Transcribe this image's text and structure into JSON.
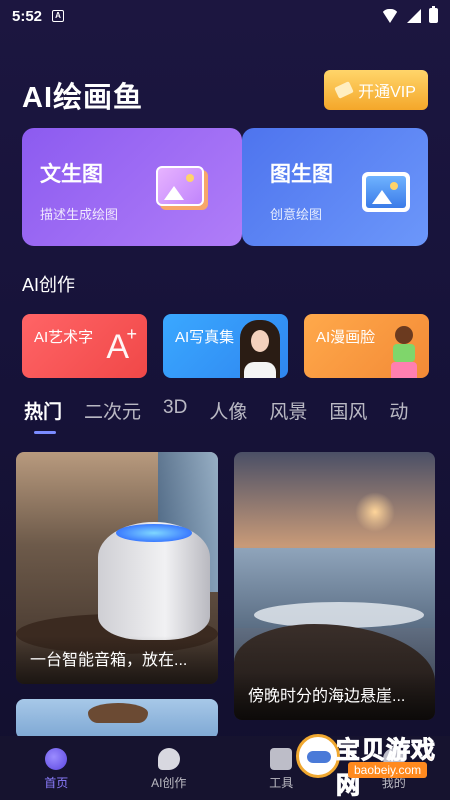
{
  "status_bar": {
    "time": "5:52",
    "notification_icon": "A"
  },
  "header": {
    "app_title": "AI绘画鱼",
    "vip_label": "开通VIP"
  },
  "features": [
    {
      "title": "文生图",
      "subtitle": "描述生成绘图",
      "icon": "image-stack-icon"
    },
    {
      "title": "图生图",
      "subtitle": "创意绘图",
      "icon": "picture-icon"
    }
  ],
  "ai_section": {
    "title": "AI创作",
    "items": [
      {
        "label": "AI艺术字",
        "icon": "letter-a-icon",
        "color": "#f04848"
      },
      {
        "label": "AI写真集",
        "icon": "portrait-photo",
        "color": "#2f86f0"
      },
      {
        "label": "AI漫画脸",
        "icon": "anime-character",
        "color": "#f38a36"
      }
    ]
  },
  "tabs": [
    {
      "label": "热门",
      "active": true
    },
    {
      "label": "二次元"
    },
    {
      "label": "3D"
    },
    {
      "label": "人像"
    },
    {
      "label": "风景"
    },
    {
      "label": "国风"
    },
    {
      "label": "动"
    }
  ],
  "gallery": [
    {
      "caption": "一台智能音箱，放在..."
    },
    {
      "caption": "傍晚时分的海边悬崖..."
    },
    {
      "caption": ""
    }
  ],
  "bottom_nav": [
    {
      "label": "首页",
      "active": true
    },
    {
      "label": "AI创作"
    },
    {
      "label": "工具"
    },
    {
      "label": "我的"
    }
  ],
  "watermark": {
    "text": "宝贝游戏网",
    "url": "baobeiy.com"
  }
}
